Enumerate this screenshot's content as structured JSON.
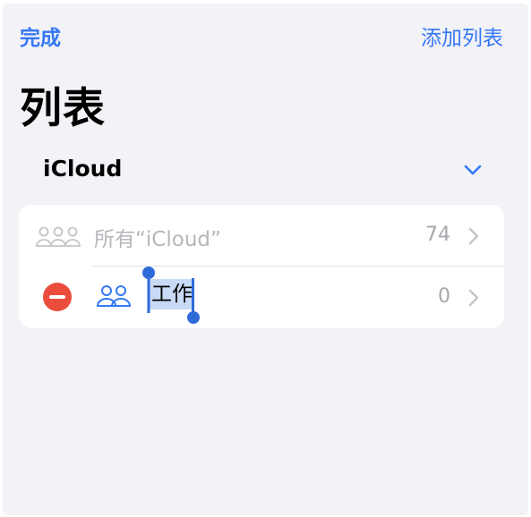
{
  "nav": {
    "done_label": "完成",
    "add_list_label": "添加列表"
  },
  "page": {
    "title": "列表"
  },
  "section": {
    "title": "iCloud",
    "chevron_icon": "chevron-down-icon"
  },
  "lists": [
    {
      "label": "所有“iCloud”",
      "count": "74",
      "icon": "people-icon",
      "muted": true
    },
    {
      "label": "工作",
      "count": "0",
      "icon": "people-icon",
      "editing": true,
      "delete_icon": "minus-circle-icon"
    }
  ],
  "colors": {
    "accent": "#3478f6",
    "delete": "#eb4d3d",
    "background": "#f2f2f7",
    "selection": "#c9daf6"
  }
}
